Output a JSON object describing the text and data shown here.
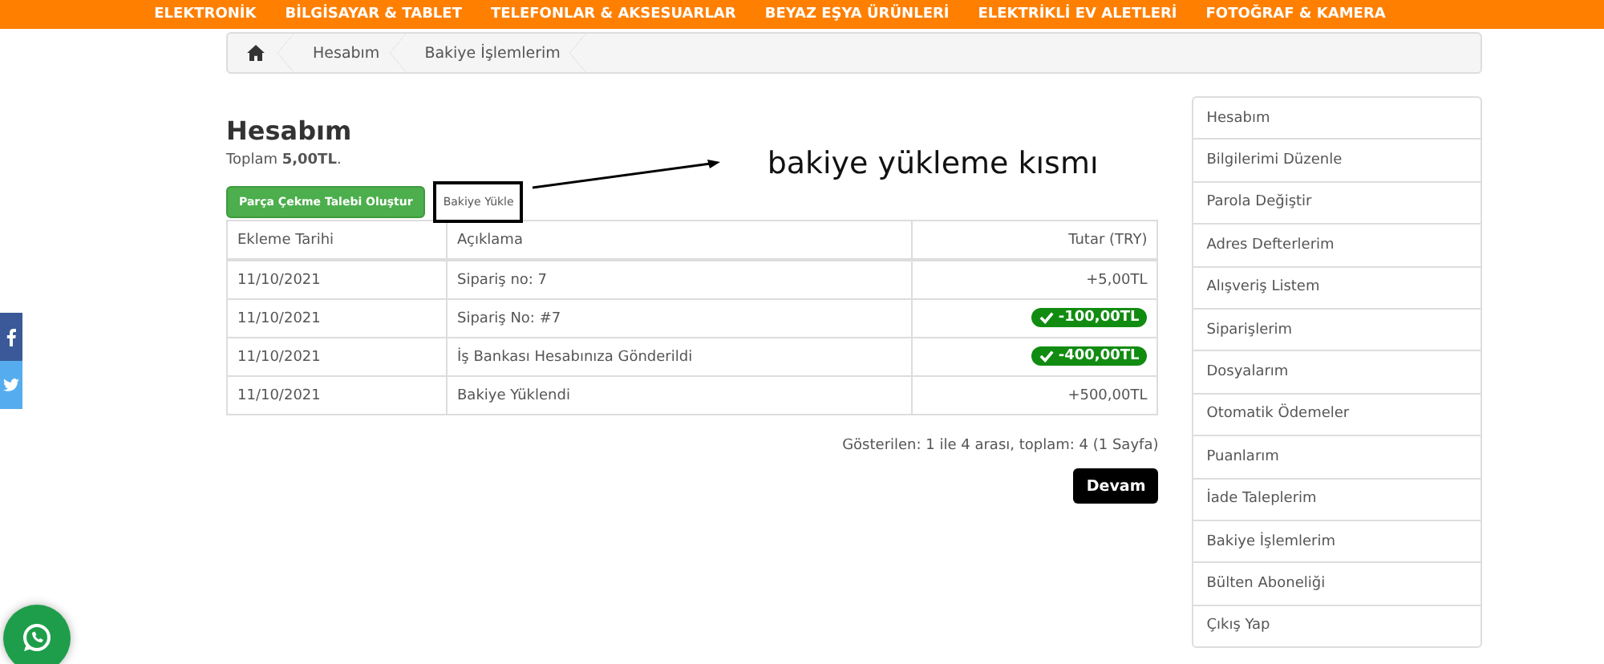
{
  "top_nav": {
    "items": [
      "ELEKTRONİK",
      "BİLGİSAYAR & TABLET",
      "TELEFONLAR & AKSESUARLAR",
      "BEYAZ EŞYA ÜRÜNLERİ",
      "ELEKTRİKLİ EV ALETLERİ",
      "FOTOĞRAF & KAMERA"
    ]
  },
  "breadcrumb": [
    "Hesabım",
    "Bakiye İşlemlerim"
  ],
  "page": {
    "title": "Hesabım",
    "total_label": "Toplam",
    "total_value": "5,00TL",
    "total_suffix": "."
  },
  "buttons": [
    {
      "label": "Parça Çekme Talebi Oluştur",
      "kind": "primary",
      "annotated": false
    },
    {
      "label": "Bakiye Yükle",
      "kind": "plain",
      "annotated": true
    }
  ],
  "annotation": {
    "text": "bakiye yükleme kısmı"
  },
  "table": {
    "columns": [
      "Ekleme Tarihi",
      "Açıklama",
      "Tutar (TRY)"
    ],
    "rows": [
      {
        "date": "11/10/2021",
        "description": "Sipariş no: 7",
        "amount": "+5,00TL",
        "kind": "plain"
      },
      {
        "date": "11/10/2021",
        "description": "Sipariş No: #7",
        "amount": "-100,00TL",
        "kind": "badge"
      },
      {
        "date": "11/10/2021",
        "description": "İş Bankası Hesabınıza Gönderildi",
        "amount": "-400,00TL",
        "kind": "badge"
      },
      {
        "date": "11/10/2021",
        "description": "Bakiye Yüklendi",
        "amount": "+500,00TL",
        "kind": "plain"
      }
    ]
  },
  "pagination": {
    "summary": "Gösterilen: 1 ile 4 arası, toplam: 4 (1 Sayfa)",
    "next_button": "Devam"
  },
  "sidebar": {
    "items": [
      "Hesabım",
      "Bilgilerimi Düzenle",
      "Parola Değiştir",
      "Adres Defterlerim",
      "Alışveriş Listem",
      "Siparişlerim",
      "Dosyalarım",
      "Otomatik Ödemeler",
      "Puanlarım",
      "İade Taleplerim",
      "Bakiye İşlemlerim",
      "Bülten Aboneliği",
      "Çıkış Yap"
    ]
  }
}
